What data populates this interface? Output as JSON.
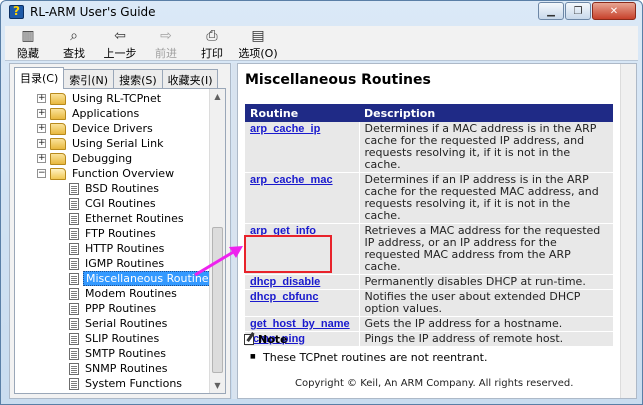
{
  "window": {
    "title": "RL-ARM User's Guide",
    "controls": [
      "minimize",
      "restore",
      "close"
    ]
  },
  "toolbar": {
    "buttons": [
      {
        "label": "隐藏",
        "icon": "hide-icon"
      },
      {
        "label": "查找",
        "icon": "find-icon"
      },
      {
        "label": "上一步",
        "icon": "back-icon"
      },
      {
        "label": "前进",
        "icon": "forward-icon",
        "disabled": true
      },
      {
        "label": "打印",
        "icon": "print-icon"
      },
      {
        "label": "选项(O)",
        "icon": "options-icon"
      }
    ]
  },
  "tabs": [
    "目录(C)",
    "索引(N)",
    "搜索(S)",
    "收藏夹(I)"
  ],
  "tree": {
    "folders": [
      {
        "label": "Using RL-TCPnet",
        "expanded": false
      },
      {
        "label": "Applications",
        "expanded": false
      },
      {
        "label": "Device Drivers",
        "expanded": false
      },
      {
        "label": "Using Serial Link",
        "expanded": false
      },
      {
        "label": "Debugging",
        "expanded": false
      },
      {
        "label": "Function Overview",
        "expanded": true
      }
    ],
    "pages": [
      "BSD Routines",
      "CGI Routines",
      "Ethernet Routines",
      "FTP Routines",
      "HTTP Routines",
      "IGMP Routines",
      "Miscellaneous Routines",
      "Modem Routines",
      "PPP Routines",
      "Serial Routines",
      "SLIP Routines",
      "SMTP Routines",
      "SNMP Routines",
      "System Functions"
    ],
    "selected": "Miscellaneous Routines"
  },
  "content": {
    "title": "Miscellaneous Routines",
    "table": {
      "headers": [
        "Routine",
        "Description"
      ],
      "rows": [
        {
          "routine": "arp_cache_ip",
          "description": "Determines if a MAC address is in the ARP cache for the requested IP address, and requests resolving it, if it is not in the cache."
        },
        {
          "routine": "arp_cache_mac",
          "description": "Determines if an IP address is in the ARP cache for the requested MAC address, and requests resolving it, if it is not in the cache."
        },
        {
          "routine": "arp_get_info",
          "description": "Retrieves a MAC address for the requested IP address, or an IP address for the requested MAC address from the ARP cache."
        },
        {
          "routine": "dhcp_disable",
          "description": "Permanently disables DHCP at run-time."
        },
        {
          "routine": "dhcp_cbfunc",
          "description": "Notifies the user about extended DHCP option values."
        },
        {
          "routine": "get_host_by_name",
          "description": "Gets the IP address for a hostname."
        },
        {
          "routine": "icmp_ping",
          "description": "Pings the IP address of remote host."
        }
      ]
    },
    "note": {
      "title": "Note",
      "items": [
        "These TCPnet routines are not reentrant."
      ]
    },
    "copyright": "Copyright © Keil, An ARM Company. All rights reserved."
  },
  "colors": {
    "table_header": "#1f2a86",
    "link": "#1a1acd",
    "selection": "#3399ff",
    "highlight_box": "#e8232b",
    "annotation_arrow": "#ee22ee"
  }
}
